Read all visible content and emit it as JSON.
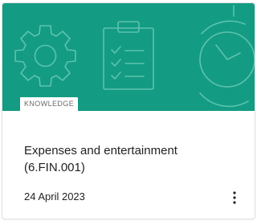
{
  "card": {
    "category": "KNOWLEDGE",
    "title_line1": "Expenses and entertainment",
    "title_line2": "(6.FIN.001)",
    "date": "24 April 2023",
    "banner_color": "#139c83",
    "banner_icons": [
      "gear-icon",
      "clipboard-checklist-icon",
      "clock-icon"
    ],
    "menu_icon": "more-vertical-icon"
  }
}
